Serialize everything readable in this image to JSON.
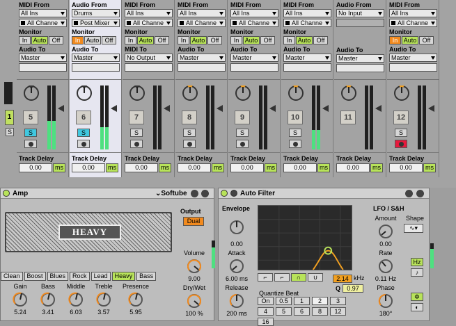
{
  "colors": {
    "accent_green": "#b8e35a",
    "solo_blue": "#40c8e0",
    "arm_red": "#e8183c",
    "meter_green": "#4ee080",
    "orange": "#f28a1e"
  },
  "master": {
    "number": "1",
    "solo": "S"
  },
  "tracks": [
    {
      "io_from_label": "MIDI From",
      "from": "All Ins",
      "channel": "All Channe",
      "monitor_label": "Monitor",
      "mon": [
        "In",
        "Auto",
        "Off"
      ],
      "mon_active": 1,
      "to_label": "Audio To",
      "to": "Master",
      "number": "5",
      "solo": "S",
      "solo_on": true,
      "delay_label": "Track Delay",
      "delay": "0.00",
      "unit": "ms",
      "meter": 0.45
    },
    {
      "io_from_label": "Audio From",
      "from": "Drums",
      "channel": "Post Mixer",
      "monitor_label": "Monitor",
      "mon": [
        "In",
        "Auto",
        "Off"
      ],
      "mon_active": 0,
      "to_label": "Audio To",
      "to": "Master",
      "number": "6",
      "solo": "S",
      "solo_on": true,
      "delay_label": "Track Delay",
      "delay": "0.00",
      "unit": "ms",
      "meter": 0.35,
      "selected": true
    },
    {
      "io_from_label": "MIDI From",
      "from": "All Ins",
      "channel": "All Channe",
      "monitor_label": "Monitor",
      "mon": [
        "In",
        "Auto",
        "Off"
      ],
      "mon_active": 1,
      "to_label": "MIDI To",
      "to": "No Output",
      "number": "7",
      "solo": "S",
      "solo_on": false,
      "delay_label": "Track Delay",
      "delay": "0.00",
      "unit": "ms",
      "meter": 0
    },
    {
      "io_from_label": "MIDI From",
      "from": "All Ins",
      "channel": "All Channe",
      "monitor_label": "Monitor",
      "mon": [
        "In",
        "Auto",
        "Off"
      ],
      "mon_active": 1,
      "to_label": "Audio To",
      "to": "Master",
      "number": "8",
      "solo": "S",
      "solo_on": false,
      "delay_label": "Track Delay",
      "delay": "0.00",
      "unit": "ms",
      "meter": 0
    },
    {
      "io_from_label": "MIDI From",
      "from": "All Ins",
      "channel": "All Channe",
      "monitor_label": "Monitor",
      "mon": [
        "In",
        "Auto",
        "Off"
      ],
      "mon_active": 1,
      "to_label": "Audio To",
      "to": "Master",
      "number": "9",
      "solo": "S",
      "solo_on": false,
      "delay_label": "Track Delay",
      "delay": "0.00",
      "unit": "ms",
      "meter": 0
    },
    {
      "io_from_label": "MIDI From",
      "from": "All Ins",
      "channel": "All Channe",
      "monitor_label": "Monitor",
      "mon": [
        "In",
        "Auto",
        "Off"
      ],
      "mon_active": 1,
      "to_label": "Audio To",
      "to": "Master",
      "number": "10",
      "solo": "S",
      "solo_on": false,
      "delay_label": "Track Delay",
      "delay": "0.00",
      "unit": "ms",
      "meter": 0.3
    },
    {
      "io_from_label": "Audio From",
      "from": "No Input",
      "channel": "",
      "monitor_label": "",
      "mon": [],
      "mon_active": -1,
      "to_label": "Audio To",
      "to": "Master",
      "number": "11",
      "solo": "",
      "solo_on": false,
      "delay_label": "Track Delay",
      "delay": "0.00",
      "unit": "ms",
      "meter": 0
    },
    {
      "io_from_label": "MIDI From",
      "from": "All Ins",
      "channel": "All Channe",
      "monitor_label": "Monitor",
      "mon": [
        "In",
        "Auto",
        "Off"
      ],
      "mon_active": 1,
      "mon_in_orange": true,
      "to_label": "Audio To",
      "to": "Master",
      "number": "12",
      "solo": "S",
      "solo_on": false,
      "arm": true,
      "delay_label": "Track Delay",
      "delay": "0.00",
      "unit": "ms",
      "meter": 0
    }
  ],
  "amp": {
    "title": "Amp",
    "brand": "Softube",
    "badge": "HEAVY",
    "output_label": "Output",
    "dual": "Dual",
    "models": [
      "Clean",
      "Boost",
      "Blues",
      "Rock",
      "Lead",
      "Heavy",
      "Bass"
    ],
    "model_active": 5,
    "knobs": [
      {
        "label": "Gain",
        "value": "5.24"
      },
      {
        "label": "Bass",
        "value": "3.41"
      },
      {
        "label": "Middle",
        "value": "6.03"
      },
      {
        "label": "Treble",
        "value": "3.57"
      },
      {
        "label": "Presence",
        "value": "5.95"
      }
    ],
    "volume_label": "Volume",
    "volume": "9.00",
    "drywet_label": "Dry/Wet",
    "drywet": "100 %"
  },
  "autofilter": {
    "title": "Auto Filter",
    "envelope_label": "Envelope",
    "envelope": "0.00",
    "attack_label": "Attack",
    "attack": "6.00 ms",
    "release_label": "Release",
    "release": "200 ms",
    "freq": "2.14",
    "freq_unit": "kHz",
    "q_label": "Q",
    "q": "0.97",
    "quantize_label": "Quantize Beat",
    "quantize": [
      "On",
      "0.5",
      "1",
      "2",
      "3",
      "4",
      "5",
      "6",
      "8",
      "12",
      "16"
    ],
    "lfo_label": "LFO / S&H",
    "amount_label": "Amount",
    "amount": "0.00",
    "shape_label": "Shape",
    "rate_label": "Rate",
    "rate": "0.11 Hz",
    "hz": "Hz",
    "phase_label": "Phase",
    "phase": "180°"
  }
}
